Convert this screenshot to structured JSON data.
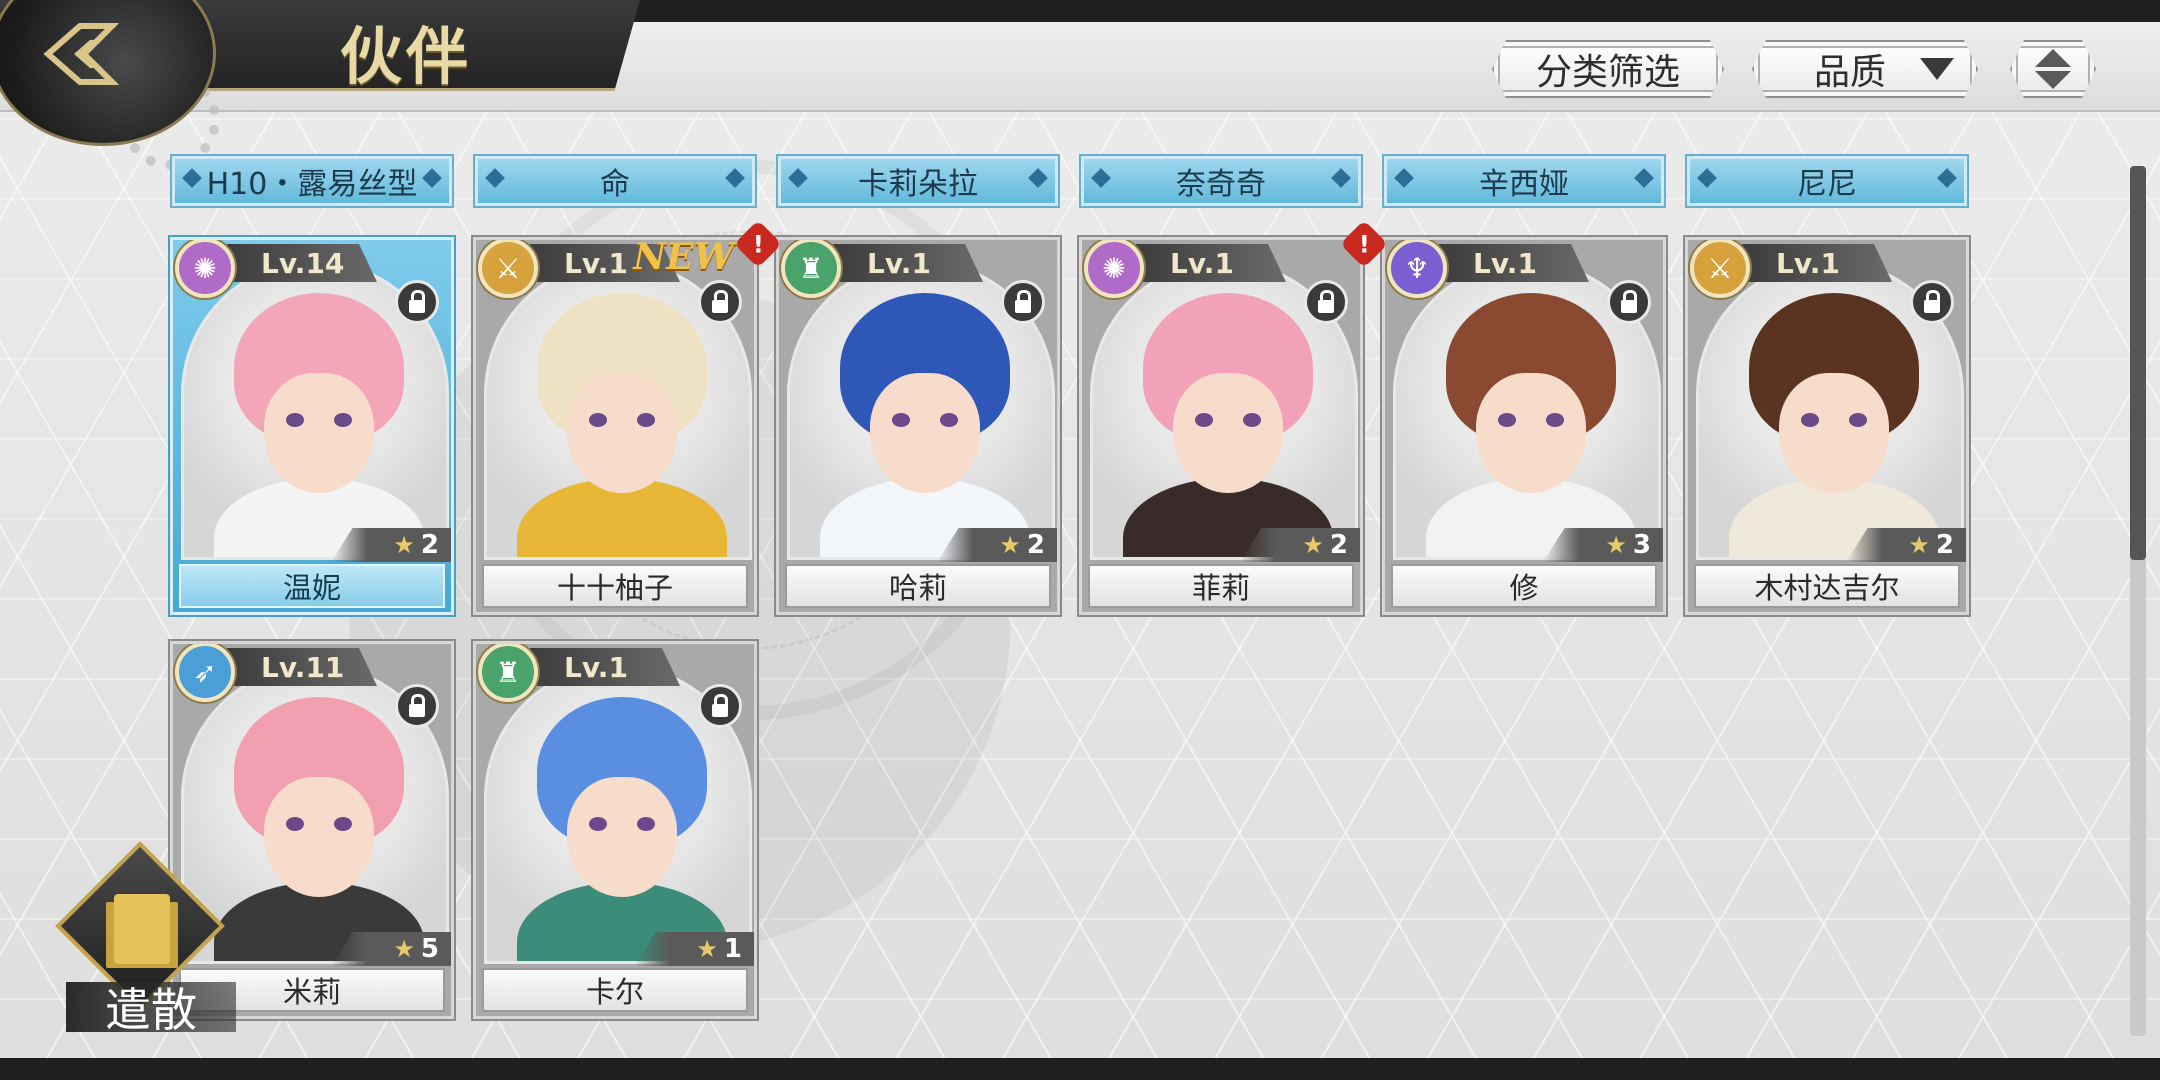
{
  "header": {
    "title": "伙伴",
    "filter_label": "分类筛选",
    "quality_label": "品质"
  },
  "top_row": [
    "H10・露易丝型",
    "命",
    "卡莉朵拉",
    "奈奇奇",
    "辛西娅",
    "尼尼"
  ],
  "cards": [
    {
      "level": "Lv.14",
      "name": "温妮",
      "stars": "2",
      "class_color": "#b06bc9",
      "class_icon": "✺",
      "theme": "blue",
      "hair": "#f2a6b8",
      "outfit": "#f4f4f4",
      "new": false,
      "alert": false
    },
    {
      "level": "Lv.1",
      "name": "十十柚子",
      "stars": "",
      "class_color": "#d7a23c",
      "class_icon": "⚔",
      "theme": "gray",
      "hair": "#efe1c3",
      "outfit": "#e9b737",
      "new": true,
      "new_label": "NEW",
      "alert": true
    },
    {
      "level": "Lv.1",
      "name": "哈莉",
      "stars": "2",
      "class_color": "#4aa36a",
      "class_icon": "♜",
      "theme": "gray",
      "hair": "#2e57b8",
      "outfit": "#f3f6fb",
      "new": false,
      "alert": false
    },
    {
      "level": "Lv.1",
      "name": "菲莉",
      "stars": "2",
      "class_color": "#b06bc9",
      "class_icon": "✺",
      "theme": "gray",
      "hair": "#f2a2b8",
      "outfit": "#3a2b2b",
      "new": false,
      "alert": true
    },
    {
      "level": "Lv.1",
      "name": "修",
      "stars": "3",
      "class_color": "#7a5fd0",
      "class_icon": "♆",
      "theme": "gray",
      "hair": "#8a4a32",
      "outfit": "#f2f2f2",
      "new": false,
      "alert": false
    },
    {
      "level": "Lv.1",
      "name": "木村达吉尔",
      "stars": "2",
      "class_color": "#d7a23c",
      "class_icon": "⚔",
      "theme": "gray",
      "hair": "#5a3420",
      "outfit": "#efe9dc",
      "new": false,
      "alert": false
    },
    {
      "level": "Lv.11",
      "name": "米莉",
      "stars": "5",
      "class_color": "#4aa0d6",
      "class_icon": "➶",
      "theme": "gray",
      "hair": "#f29fb0",
      "outfit": "#3a3a3a",
      "new": false,
      "alert": false
    },
    {
      "level": "Lv.1",
      "name": "卡尔",
      "stars": "1",
      "class_color": "#4aa36a",
      "class_icon": "♜",
      "theme": "gray",
      "hair": "#5a8ee0",
      "outfit": "#3c8c7a",
      "new": false,
      "alert": false
    }
  ],
  "alert_label": "!",
  "dismiss_label": "遣散"
}
